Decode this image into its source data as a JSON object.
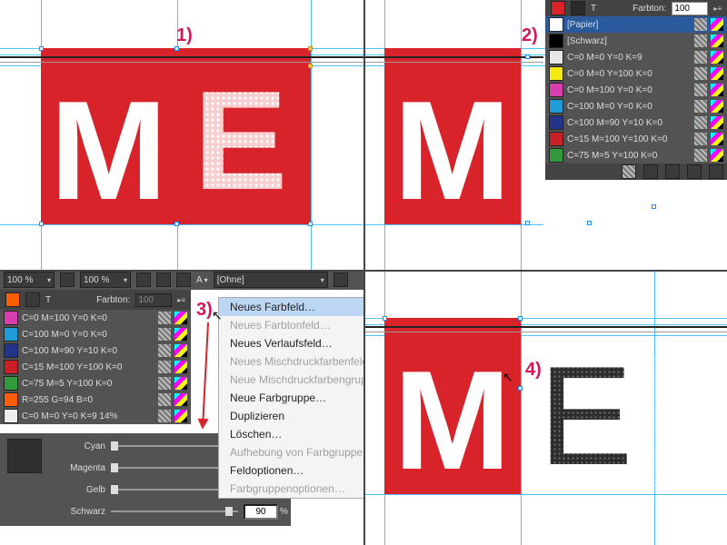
{
  "steps": {
    "s1": "1)",
    "s2": "2)",
    "s3": "3)",
    "s4": "4)"
  },
  "letters": {
    "m": "M",
    "e": "E"
  },
  "swatch_panel": {
    "tint_label": "Farbton:",
    "tint_value": "100",
    "rows": [
      {
        "name": "[Papier]",
        "color": "#ffffff"
      },
      {
        "name": "[Schwarz]",
        "color": "#000000"
      },
      {
        "name": "C=0 M=0 Y=0 K=9",
        "color": "#e6e6e6"
      },
      {
        "name": "C=0 M=0 Y=100 K=0",
        "color": "#f5ea14"
      },
      {
        "name": "C=0 M=100 Y=0 K=0",
        "color": "#d93eaf"
      },
      {
        "name": "C=100 M=0 Y=0 K=0",
        "color": "#1f9cd8"
      },
      {
        "name": "C=100 M=90 Y=10 K=0",
        "color": "#22338a"
      },
      {
        "name": "C=15 M=100 Y=100 K=0",
        "color": "#c72026"
      },
      {
        "name": "C=75 M=5 Y=100 K=0",
        "color": "#319a3d"
      }
    ]
  },
  "toolbar3": {
    "pct_left": "100 %",
    "pct_right": "100 %",
    "style_dd": "[Ohne]"
  },
  "swatch_panel_3": {
    "tint_label": "Farbton:",
    "tint_value": "100",
    "rows": [
      {
        "name": "C=0 M=100 Y=0 K=0",
        "color": "#d93eaf"
      },
      {
        "name": "C=100 M=0 Y=0 K=0",
        "color": "#1f9cd8"
      },
      {
        "name": "C=100 M=90 Y=10 K=0",
        "color": "#22338a"
      },
      {
        "name": "C=15 M=100 Y=100 K=0",
        "color": "#c72026"
      },
      {
        "name": "C=75 M=5 Y=100 K=0",
        "color": "#319a3d"
      },
      {
        "name": "R=255 G=94 B=0",
        "color": "#ff5e00"
      },
      {
        "name": "C=0 M=0 Y=0 K=9 14%",
        "color": "#ededed"
      }
    ]
  },
  "sliders": {
    "preview_color": "#303030",
    "rows": [
      {
        "label": "Cyan",
        "value": "0",
        "pos": 0
      },
      {
        "label": "Magenta",
        "value": "0",
        "pos": 0
      },
      {
        "label": "Gelb",
        "value": "0",
        "pos": 0
      },
      {
        "label": "Schwarz",
        "value": "90",
        "pos": 0.9
      }
    ]
  },
  "flyout": {
    "items": [
      {
        "label": "Neues Farbfeld…",
        "state": "hi"
      },
      {
        "label": "Neues Farbtonfeld…",
        "state": "dis"
      },
      {
        "label": "Neues Verlaufsfeld…",
        "state": ""
      },
      {
        "label": "Neues Mischdruckfarbenfeld…",
        "state": "dis"
      },
      {
        "label": "Neue Mischdruckfarbengruppe…",
        "state": "dis"
      },
      {
        "label": "Neue Farbgruppe…",
        "state": ""
      },
      {
        "label": "Duplizieren",
        "state": "cut"
      },
      {
        "label": "Löschen…",
        "state": "cut"
      },
      {
        "label": "Aufhebung von Farbgruppe",
        "state": "cut-dis"
      },
      {
        "label": "Feldoptionen…",
        "state": "cut"
      },
      {
        "label": "Farbgruppenoptionen…",
        "state": "cut-dis"
      }
    ]
  },
  "pct_unit": "%",
  "chart_data": null
}
